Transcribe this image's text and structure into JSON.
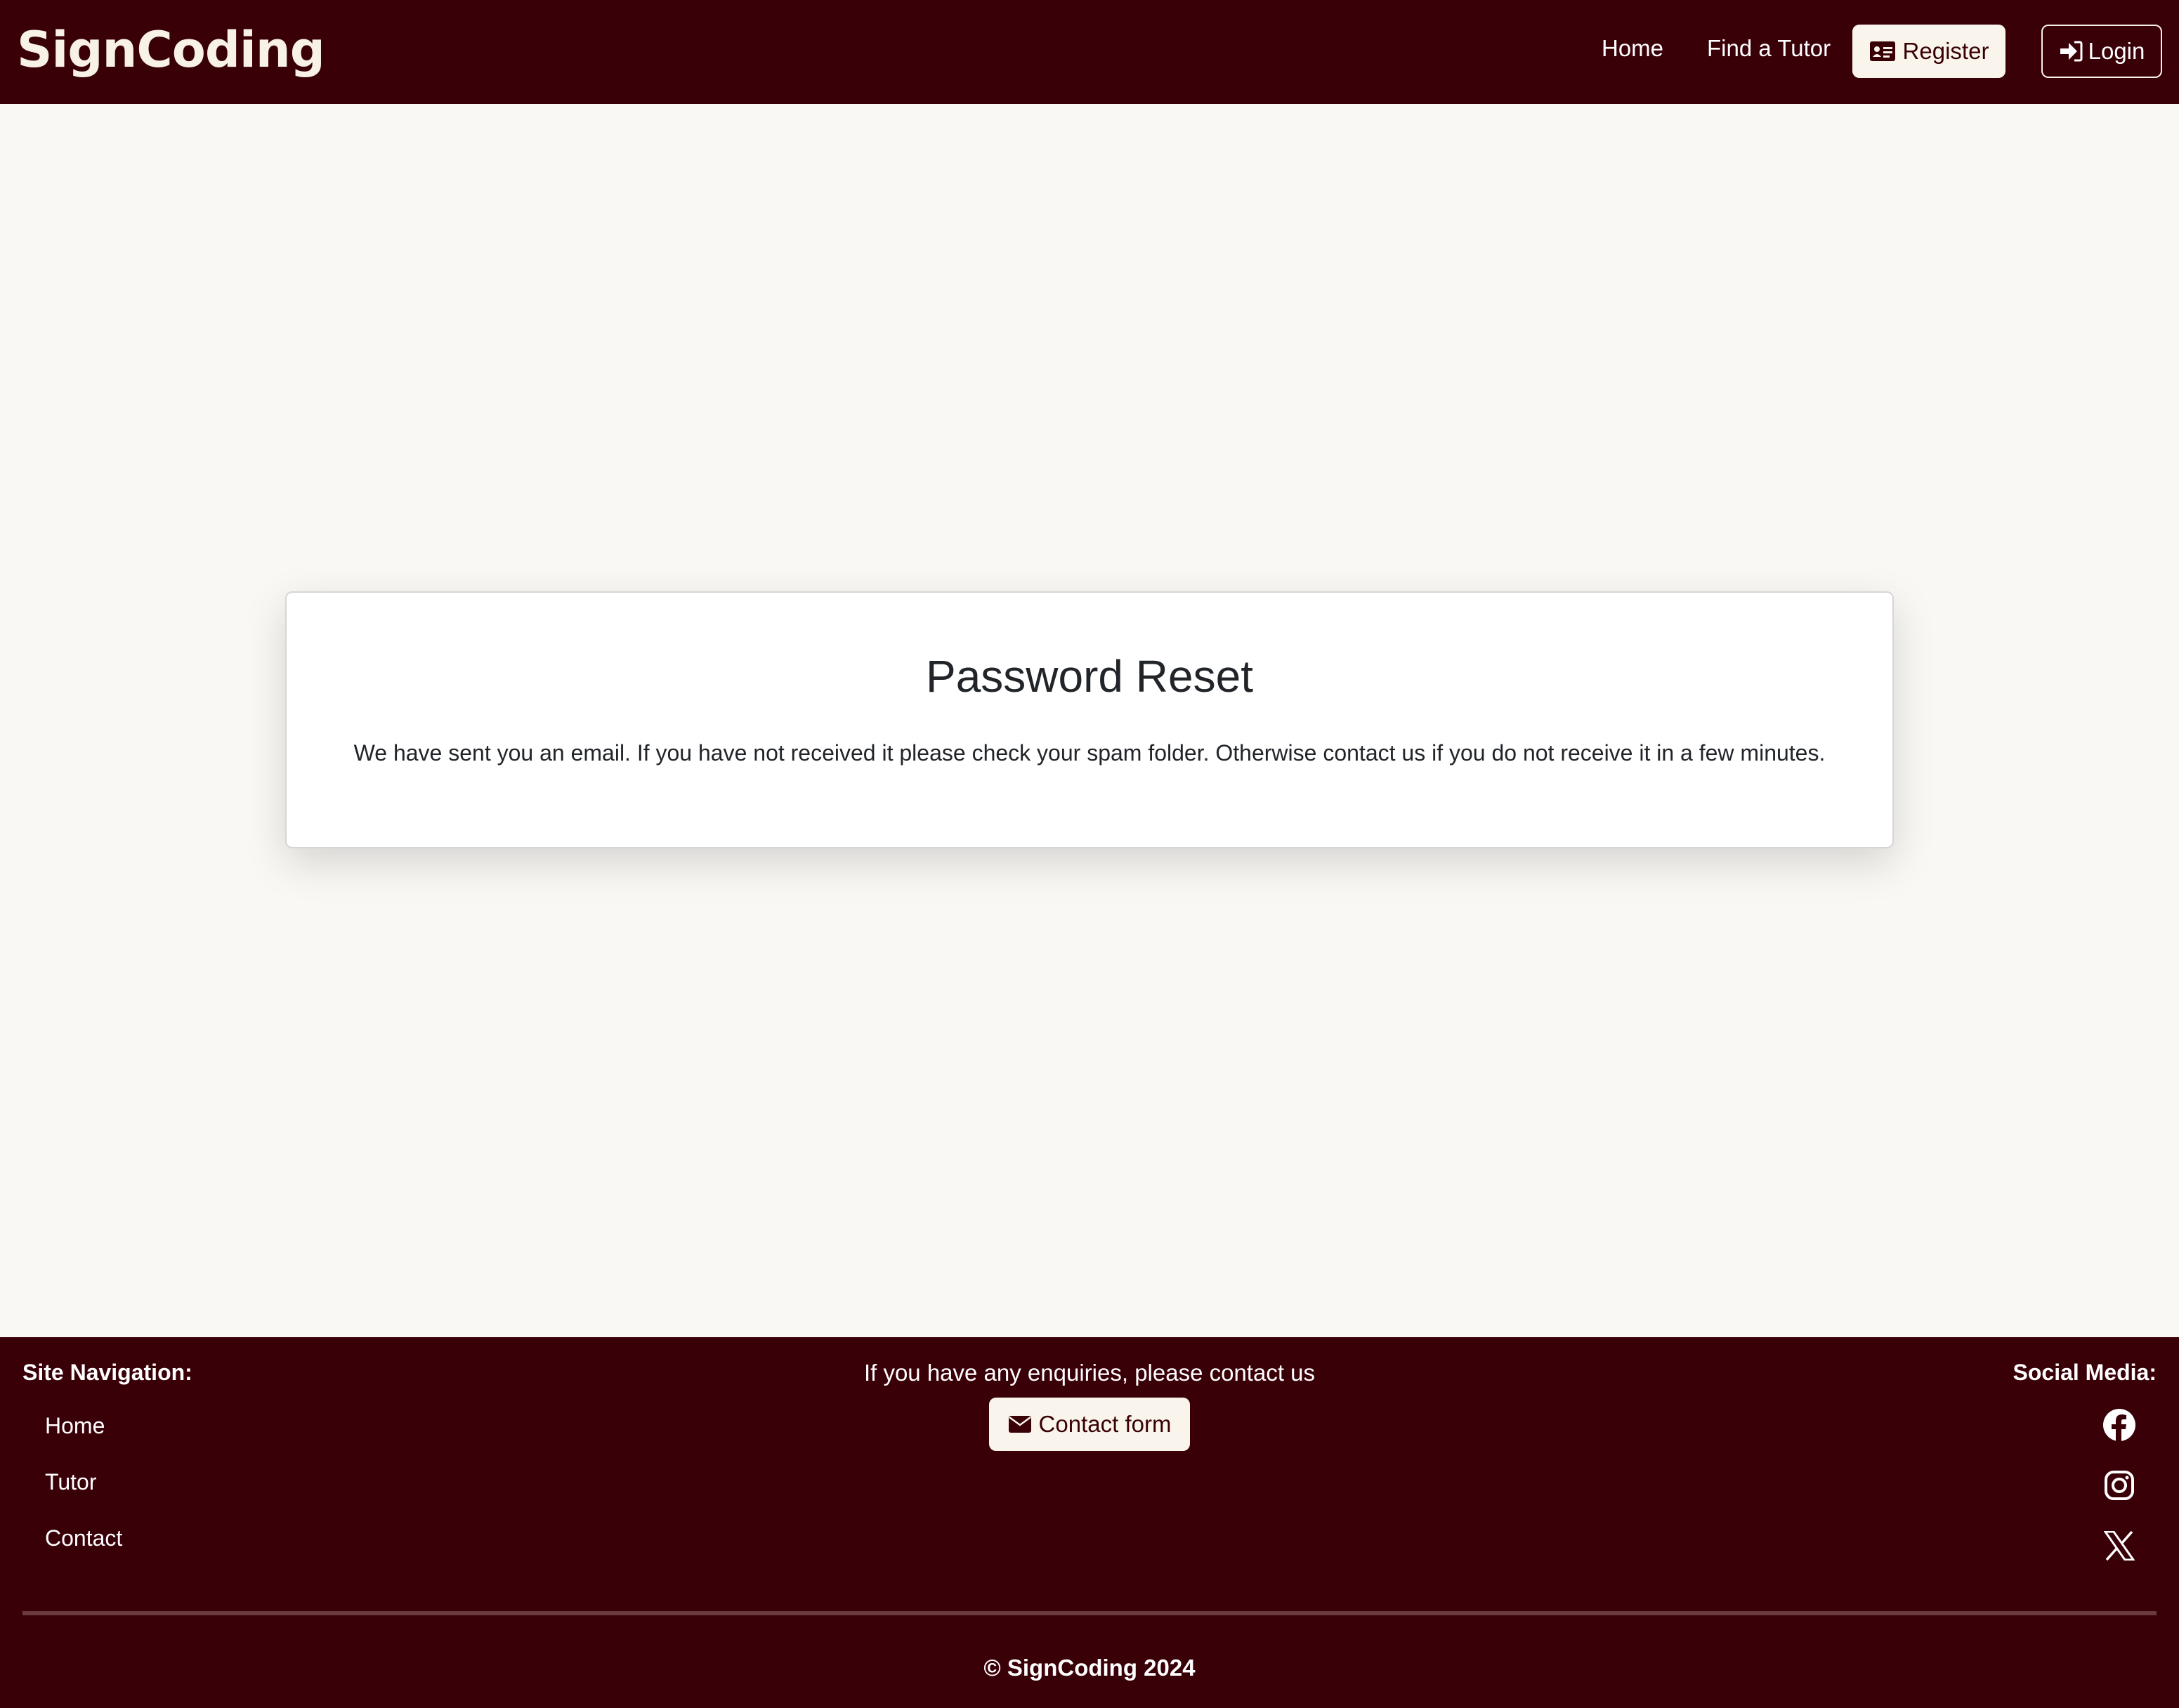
{
  "header": {
    "brand": "SignCoding",
    "nav": {
      "home": "Home",
      "find_tutor": "Find a Tutor",
      "register": "Register",
      "login": "Login"
    }
  },
  "card": {
    "title": "Password Reset",
    "message": "We have sent you an email. If you have not received it please check your spam folder. Otherwise contact us if you do not receive it in a few minutes."
  },
  "footer": {
    "site_nav_heading": "Site Navigation:",
    "site_nav_items": [
      "Home",
      "Tutor",
      "Contact"
    ],
    "enquiry_text": "If you have any enquiries, please contact us",
    "contact_button": "Contact form",
    "social_heading": "Social Media:",
    "social_icons": [
      "facebook-icon",
      "instagram-icon",
      "x-icon"
    ],
    "copyright": "© SignCoding 2024"
  },
  "colors": {
    "brand_dark": "#3a0008",
    "page_bg": "#f9f8f4",
    "button_light": "#f9f5ec"
  }
}
